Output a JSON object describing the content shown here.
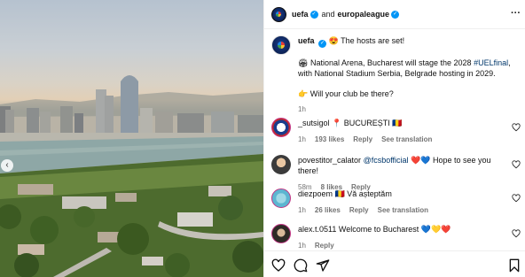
{
  "header": {
    "account1": "uefa",
    "joiner": "and",
    "account2": "europaleague"
  },
  "caption": {
    "username": "uefa",
    "line1": "The hosts are set!",
    "line2_pre": "National Arena, Bucharest will stage the 2028 ",
    "line2_hashtag": "#UELfinal",
    "line2_post": ", with National Stadium Serbia, Belgrade hosting in 2029.",
    "line3": "Will your club be there?",
    "time": "1h",
    "emoji1": "😍",
    "emoji2": "🏟",
    "emoji3": "👉"
  },
  "comments": [
    {
      "username": "_sutsigol",
      "text": "BUCUREȘTI",
      "emoji_pre": "📍",
      "emoji_post": "🇷🇴",
      "time": "1h",
      "likes": "193 likes",
      "reply": "Reply",
      "translate": "See translation"
    },
    {
      "username": "povestitor_calator",
      "mention": "@fcsbofficial",
      "emoji_pre": "❤️💙",
      "text": "Hope to see you there!",
      "time": "58m",
      "likes": "8 likes",
      "reply": "Reply"
    },
    {
      "username": "diezpoem",
      "emoji_pre": "🇷🇴",
      "text": "Vă așteptăm",
      "time": "1h",
      "likes": "26 likes",
      "reply": "Reply",
      "translate": "See translation"
    },
    {
      "username": "alex.t.0511",
      "text": "Welcome to Bucharest",
      "emoji_post": "💙💛❤️",
      "time": "1h",
      "likes": "",
      "reply": "Reply"
    }
  ],
  "icons": {
    "more": "more-options-icon",
    "prev": "chevron-left-icon",
    "like": "heart-icon",
    "comment": "comment-icon",
    "share": "share-icon",
    "save": "bookmark-icon"
  },
  "colors": {
    "link": "#00376b",
    "verified": "#0095f6",
    "muted": "#737373"
  }
}
